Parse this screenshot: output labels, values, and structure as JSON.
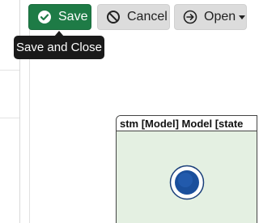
{
  "toolbar": {
    "save_label": "Save",
    "cancel_label": "Cancel",
    "open_label": "Open",
    "save_color": "#1e7b46"
  },
  "tooltip": {
    "text": "Save and Close"
  },
  "diagram": {
    "frame_title": "stm [Model] Model [state",
    "frame_fill": "#e4f0e2",
    "initial_state_color": "#1a4f9c"
  },
  "icons": {
    "save": "check-circle-icon",
    "cancel": "ban-icon",
    "open": "arrow-circle-right-icon",
    "open_menu": "caret-down-icon"
  }
}
